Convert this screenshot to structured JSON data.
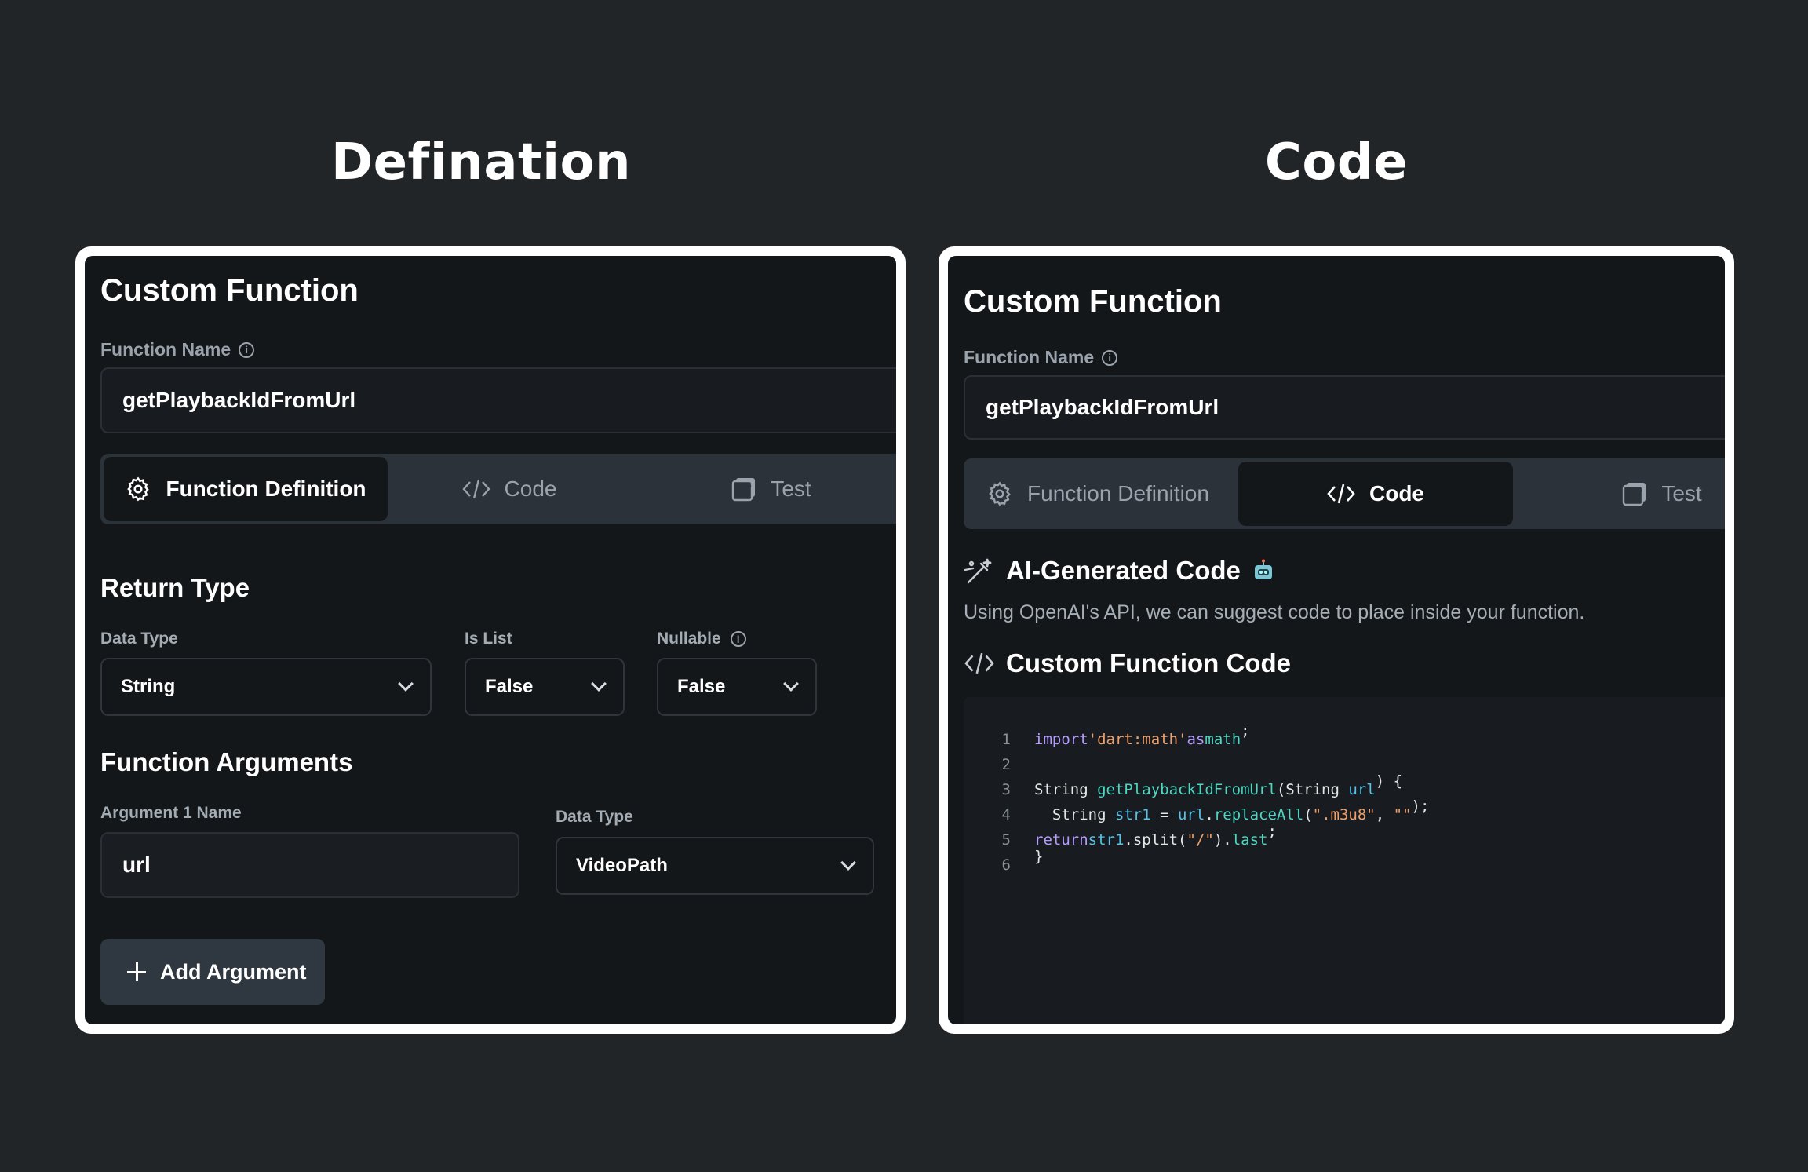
{
  "headings": {
    "left": "Defination",
    "right": "Code"
  },
  "left_panel": {
    "title": "Custom Function",
    "function_name_label": "Function Name",
    "function_name_value": "getPlaybackIdFromUrl",
    "tabs": [
      {
        "label": "Function Definition",
        "icon": "gear-icon",
        "active": true
      },
      {
        "label": "Code",
        "icon": "code-icon",
        "active": false
      },
      {
        "label": "Test",
        "icon": "test-icon",
        "active": false
      }
    ],
    "return_type": {
      "title": "Return Type",
      "data_type_label": "Data Type",
      "data_type_value": "String",
      "is_list_label": "Is List",
      "is_list_value": "False",
      "nullable_label": "Nullable",
      "nullable_value": "False"
    },
    "arguments": {
      "title": "Function Arguments",
      "arg1_name_label": "Argument 1 Name",
      "arg1_name_value": "url",
      "arg1_type_label": "Data Type",
      "arg1_type_value": "VideoPath",
      "add_button": "Add Argument"
    }
  },
  "right_panel": {
    "title": "Custom Function",
    "function_name_label": "Function Name",
    "function_name_value": "getPlaybackIdFromUrl",
    "tabs": [
      {
        "label": "Function Definition",
        "icon": "gear-icon",
        "active": false
      },
      {
        "label": "Code",
        "icon": "code-icon",
        "active": true
      },
      {
        "label": "Test",
        "icon": "test-icon",
        "active": false
      }
    ],
    "ai_title": "AI-Generated Code",
    "ai_description": "Using OpenAI's API, we can suggest code to place inside your function.",
    "code_title": "Custom Function Code",
    "code_lines": [
      {
        "n": "1",
        "text": "import 'dart:math' as math;"
      },
      {
        "n": "2",
        "text": ""
      },
      {
        "n": "3",
        "text": "String getPlaybackIdFromUrl(String url) {"
      },
      {
        "n": "4",
        "text": "  String str1 = url.replaceAll(\".m3u8\", \"\");"
      },
      {
        "n": "5",
        "text": "  return str1.split(\"/\").last;"
      },
      {
        "n": "6",
        "text": "}"
      }
    ]
  },
  "colors": {
    "background": "#212528",
    "panel": "#13171a",
    "tab_bar": "#2b3239",
    "keyword": "#b59bff",
    "string": "#f0a06b",
    "function": "#4ed6c0"
  }
}
